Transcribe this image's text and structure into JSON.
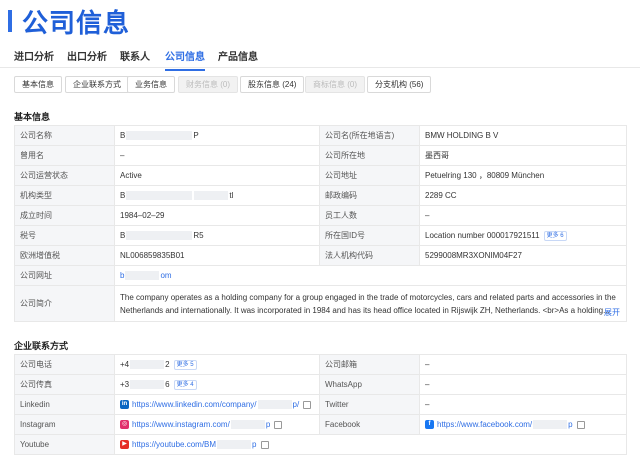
{
  "header": {
    "title": "公司信息"
  },
  "tabs": [
    {
      "label": "进口分析"
    },
    {
      "label": "出口分析"
    },
    {
      "label": "联系人"
    },
    {
      "label": "公司信息"
    },
    {
      "label": "产品信息"
    }
  ],
  "subtabs": [
    {
      "label": "基本信息"
    },
    {
      "label": "企业联系方式"
    },
    {
      "label": "业务信息"
    },
    {
      "label": "财务信息 (0)"
    },
    {
      "label": "股东信息 (24)"
    },
    {
      "label": "商标信息 (0)"
    },
    {
      "label": "分支机构 (56)"
    }
  ],
  "basic": {
    "title": "基本信息",
    "labels": {
      "company_name": "公司名称",
      "former_name": "曾用名",
      "status": "公司运营状态",
      "org_type": "机构类型",
      "founded": "成立时间",
      "tax_id": "税号",
      "vat": "欧洲增值税",
      "website": "公司网址",
      "intro": "公司简介",
      "name_local": "公司名(所在地语言)",
      "location": "公司所在地",
      "address": "公司地址",
      "postcode": "邮政编码",
      "employees": "员工人数",
      "country_id": "所在国ID号",
      "lei": "法人机构代码"
    },
    "values": {
      "company_name_a": "B",
      "company_name_b": "P",
      "former_name": "–",
      "status": "Active",
      "org_type_a": "B",
      "org_type_b": "tl",
      "founded": "1984–02–29",
      "tax_id_a": "B",
      "tax_id_b": "R5",
      "vat": "NL006859835B01",
      "website_a": "b",
      "website_b": "om",
      "intro": "The company operates as a holding company for a group engaged in the trade of motorcycles, cars and related parts and accessories in the Netherlands and internationally. It was incorporated in 1984 and has its head office located in Rijswijk ZH, Netherlands. <br>As a holding...",
      "expand": "展开",
      "name_local": "BMW HOLDING B V",
      "location": "墨西哥",
      "address": "Petuelring 130 ，80809 München",
      "postcode": "2289 CC",
      "employees": "–",
      "country_id": "Location number 000017921511",
      "country_id_more": "更多 6",
      "lei": "5299008MR3XONIM04F27"
    }
  },
  "contact": {
    "title": "企业联系方式",
    "labels": {
      "phone": "公司电话",
      "fax": "公司传真",
      "linkedin": "Linkedin",
      "instagram": "Instagram",
      "youtube": "Youtube",
      "email": "公司邮箱",
      "whatsapp": "WhatsApp",
      "twitter": "Twitter",
      "facebook": "Facebook"
    },
    "values": {
      "phone_a": "+4",
      "phone_b": "2",
      "phone_more": "更多 5",
      "fax_a": "+3",
      "fax_b": "6",
      "fax_more": "更多 4",
      "linkedin_a": "https://www.linkedin.com/company/",
      "linkedin_b": "p/",
      "instagram_a": "https://www.instagram.com/",
      "instagram_b": "p",
      "youtube_a": "https://youtube.com/BM",
      "youtube_b": "p",
      "email": "–",
      "whatsapp": "–",
      "twitter": "–",
      "facebook_a": "https://www.facebook.com/",
      "facebook_b": "p"
    }
  },
  "colors": {
    "accent": "#2f6ee4",
    "label_bg": "#f5f6f8",
    "border": "#e8e8e8"
  }
}
